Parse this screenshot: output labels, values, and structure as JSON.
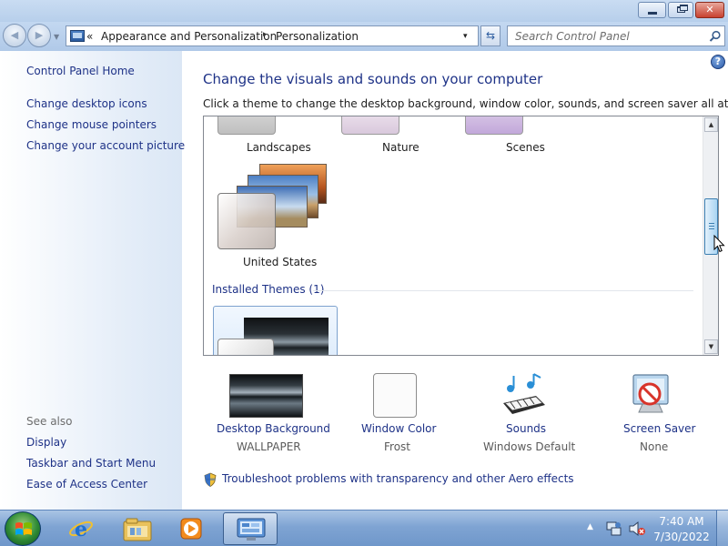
{
  "window": {
    "minimize_icon": "minimize-icon",
    "maximize_icon": "restore-icon",
    "close_glyph": "✕"
  },
  "navigation": {
    "back_icon": "back-arrow-icon",
    "forward_icon": "forward-arrow-icon",
    "overflow": "«",
    "breadcrumb": [
      "Appearance and Personalization",
      "Personalization"
    ],
    "separator": "▸",
    "dropdown": "▾",
    "refresh": "⇆"
  },
  "search": {
    "placeholder": "Search Control Panel"
  },
  "left_pane": {
    "home": "Control Panel Home",
    "links": [
      "Change desktop icons",
      "Change mouse pointers",
      "Change your account picture"
    ],
    "see_also_title": "See also",
    "see_also": [
      "Display",
      "Taskbar and Start Menu",
      "Ease of Access Center"
    ]
  },
  "main": {
    "title": "Change the visuals and sounds on your computer",
    "subtitle": "Click a theme to change the desktop background, window color, sounds, and screen saver all at once.",
    "help": "?",
    "themes_top_row": [
      "Landscapes",
      "Nature",
      "Scenes"
    ],
    "theme_single": "United States",
    "installed_header": "Installed Themes (1)"
  },
  "options": [
    {
      "link": "Desktop Background",
      "value": "WALLPAPER"
    },
    {
      "link": "Window Color",
      "value": "Frost"
    },
    {
      "link": "Sounds",
      "value": "Windows Default"
    },
    {
      "link": "Screen Saver",
      "value": "None"
    }
  ],
  "troubleshoot": "Troubleshoot problems with transparency and other Aero effects",
  "taskbar": {
    "tray_arrow": "▲",
    "time": "7:40 AM",
    "date": "7/30/2022"
  },
  "colors": {
    "link": "#1e3287",
    "accent_blue": "#3c7fb1",
    "close_red": "#c8412f"
  }
}
